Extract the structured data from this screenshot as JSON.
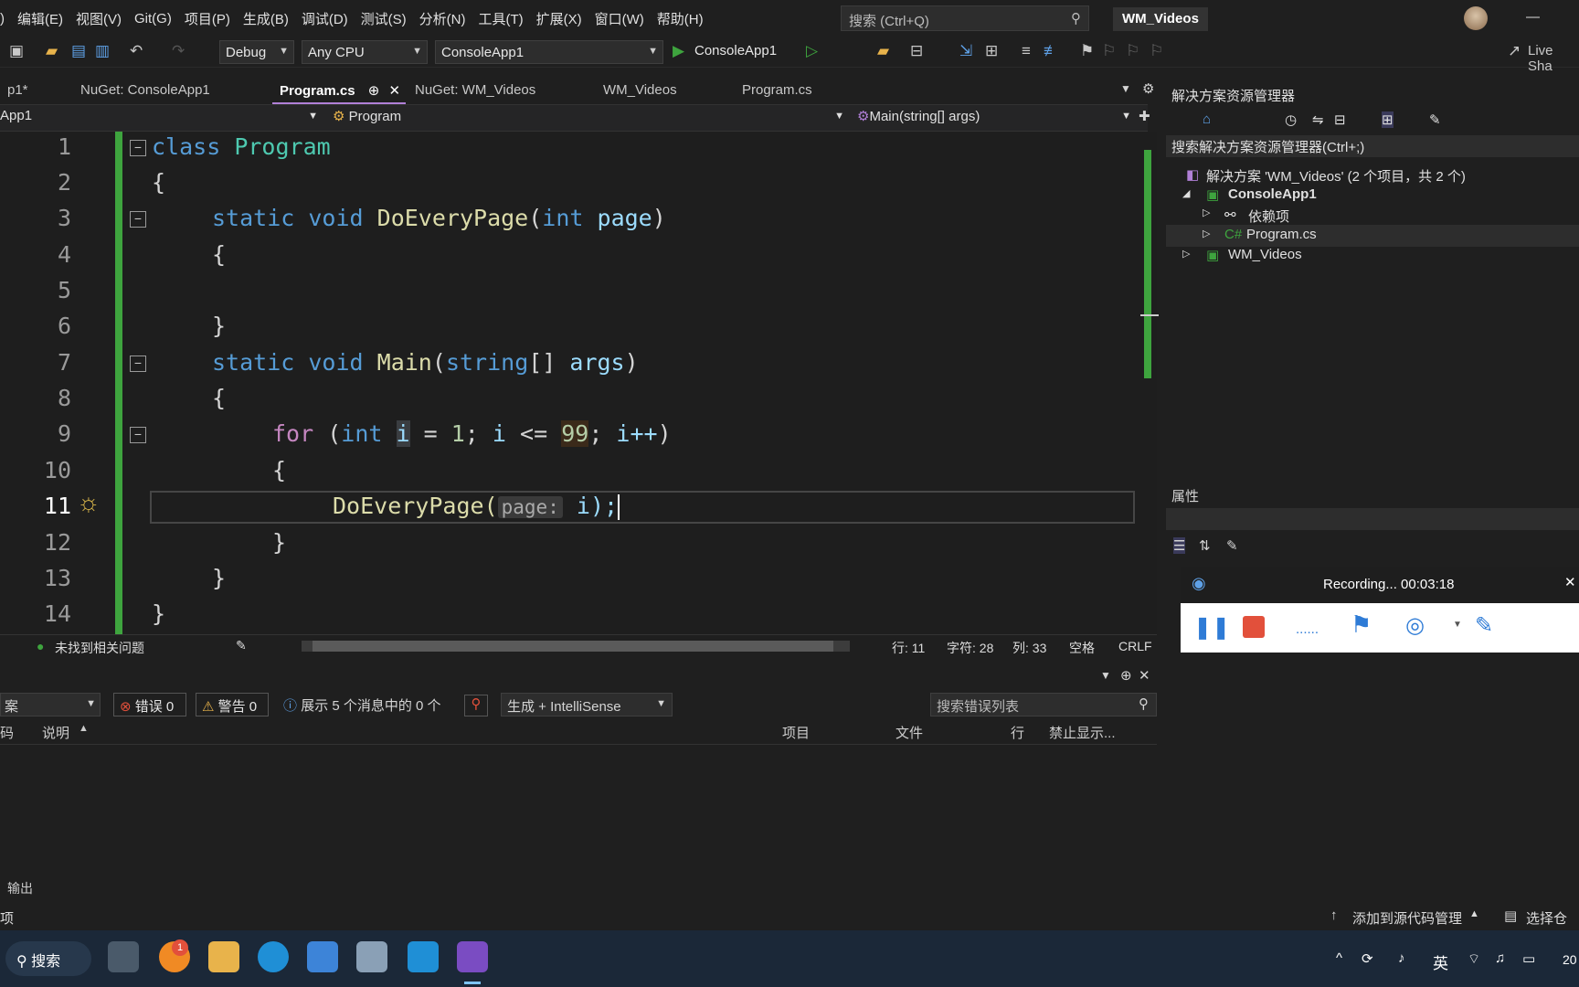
{
  "menu": [
    "编辑(E)",
    "视图(V)",
    "Git(G)",
    "项目(P)",
    "生成(B)",
    "调试(D)",
    "测试(S)",
    "分析(N)",
    "工具(T)",
    "扩展(X)",
    "窗口(W)",
    "帮助(H)"
  ],
  "search": {
    "placeholder": "搜索 (Ctrl+Q)"
  },
  "window_title": "WM_Videos",
  "toolbar": {
    "config": "Debug",
    "platform": "Any CPU",
    "startup": "ConsoleApp1",
    "run": "ConsoleApp1",
    "liveshare": "Live Sha"
  },
  "tabs": [
    "p1*",
    "NuGet: ConsoleApp1",
    "Program.cs",
    "NuGet: WM_Videos",
    "WM_Videos",
    "Program.cs"
  ],
  "nav": {
    "project": "App1",
    "type": "Program",
    "member": "Main(string[] args)"
  },
  "line_numbers": [
    "1",
    "2",
    "3",
    "4",
    "5",
    "6",
    "7",
    "8",
    "9",
    "10",
    "11",
    "12",
    "13",
    "14"
  ],
  "code": {
    "l1_kw": "class",
    "l1_name": "Program",
    "l2": "{",
    "l3_static": "static",
    "l3_void": "void",
    "l3_fn": "DoEveryPage",
    "l3_int": "int",
    "l3_param": "page",
    "l4": "{",
    "l6": "}",
    "l7_static": "static",
    "l7_void": "void",
    "l7_fn": "Main",
    "l7_type": "string",
    "l7_param": "args",
    "l8": "{",
    "l9_for": "for",
    "l9_int": "int",
    "l9_i": "i",
    "l9_one": "1",
    "l9_cmp": "<=",
    "l9_max": "99",
    "l9_inc": "i++",
    "l10": "{",
    "l11_fn": "DoEveryPage(",
    "l11_hint": "page:",
    "l11_arg": "i);",
    "l12": "}",
    "l13": "}",
    "l14": "}"
  },
  "status": {
    "issues": "未找到相关问题",
    "line": "行: 11",
    "char": "字符: 28",
    "col": "列: 33",
    "space": "空格",
    "eol": "CRLF"
  },
  "solution_explorer": {
    "title": "解决方案资源管理器",
    "search": "搜索解决方案资源管理器(Ctrl+;)",
    "solution": "解决方案 'WM_Videos' (2 个项目，共 2 个)",
    "project1": "ConsoleApp1",
    "deps": "依赖项",
    "file": "Program.cs",
    "project2": "WM_Videos"
  },
  "properties": {
    "title": "属性"
  },
  "recording": {
    "text": "Recording... 00:03:18"
  },
  "errors": {
    "scope": "案",
    "errors": "错误 0",
    "warnings": "警告 0",
    "messages": "展示 5 个消息中的 0 个",
    "source": "生成 + IntelliSense",
    "search": "搜索错误列表",
    "cols": [
      "码",
      "说明",
      "项目",
      "文件",
      "行",
      "禁止显示..."
    ]
  },
  "output_tab": "输出",
  "bottom": {
    "left": "项",
    "scm": "添加到源代码管理",
    "repo": "选择仓库"
  },
  "taskbar": {
    "search": "搜索",
    "ime": "英",
    "clock": "20",
    "notif": "1"
  }
}
